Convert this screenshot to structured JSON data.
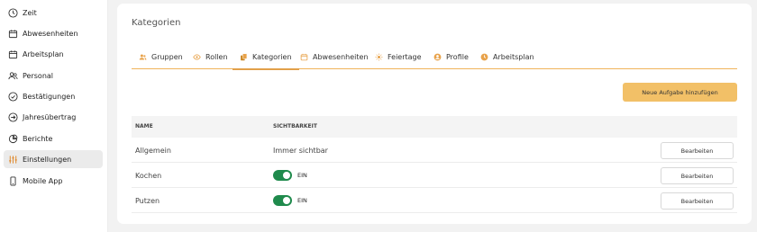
{
  "sidebar": {
    "items": [
      {
        "label": "Zeit",
        "icon": "clock-icon"
      },
      {
        "label": "Abwesenheiten",
        "icon": "calendar-icon"
      },
      {
        "label": "Arbeitsplan",
        "icon": "calendar-icon"
      },
      {
        "label": "Personal",
        "icon": "users-icon"
      },
      {
        "label": "Bestätigungen",
        "icon": "check-circle-icon"
      },
      {
        "label": "Jahresübertrag",
        "icon": "arrow-circle-icon"
      },
      {
        "label": "Berichte",
        "icon": "pie-chart-icon"
      },
      {
        "label": "Einstellungen",
        "icon": "sliders-icon",
        "active": true
      },
      {
        "label": "Mobile App",
        "icon": "phone-icon"
      }
    ]
  },
  "main": {
    "title": "Kategorien",
    "tabs": [
      {
        "label": "Gruppen",
        "icon": "users-icon"
      },
      {
        "label": "Rollen",
        "icon": "eye-icon"
      },
      {
        "label": "Kategorien",
        "icon": "copy-icon",
        "active": true
      },
      {
        "label": "Abwesenheiten",
        "icon": "calendar-icon"
      },
      {
        "label": "Feiertage",
        "icon": "sun-icon"
      },
      {
        "label": "Profile",
        "icon": "user-circle-icon"
      },
      {
        "label": "Arbeitsplan",
        "icon": "clock-icon"
      }
    ],
    "add_button": "Neue Aufgabe hinzufügen",
    "table": {
      "columns": [
        "NAME",
        "SICHTBARKEIT"
      ],
      "rows": [
        {
          "name": "Allgemein",
          "visibility": "Immer sichtbar",
          "action": "Bearbeiten"
        },
        {
          "name": "Kochen",
          "toggle_label": "EIN",
          "toggle_on": true,
          "action": "Bearbeiten"
        },
        {
          "name": "Putzen",
          "toggle_label": "EIN",
          "toggle_on": true,
          "action": "Bearbeiten"
        }
      ]
    }
  },
  "colors": {
    "accent": "#f2c067",
    "tab_underline": "#e2a04a",
    "toggle_on": "#1f8a4c",
    "sidebar_active_bg": "#ebebeb"
  }
}
